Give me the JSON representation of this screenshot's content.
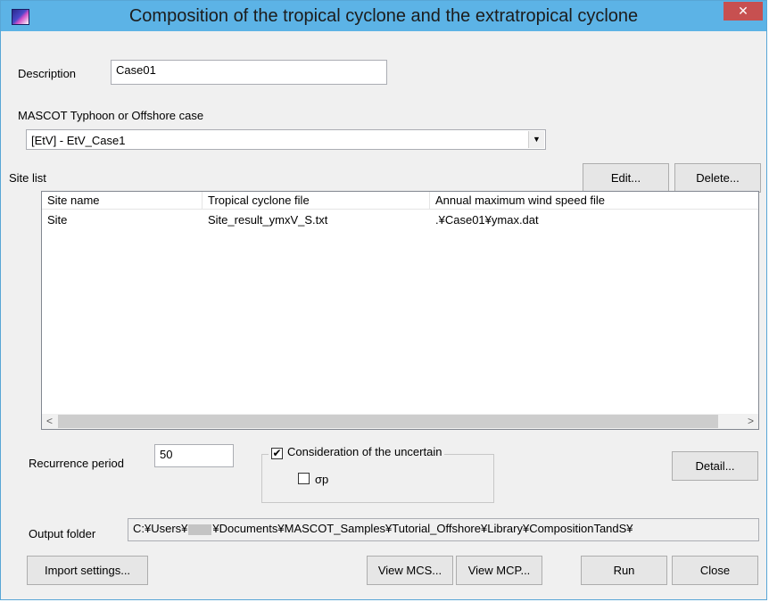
{
  "window": {
    "title": "Composition of the tropical cyclone and the extratropical cyclone",
    "close_glyph": "✕"
  },
  "description": {
    "label": "Description",
    "value": "Case01"
  },
  "mascot_case": {
    "label": "MASCOT Typhoon or Offshore case",
    "selected": "[EtV] - EtV_Case1"
  },
  "site_list": {
    "label": "Site list",
    "edit_label": "Edit...",
    "delete_label": "Delete...",
    "columns": [
      "Site name",
      "Tropical cyclone file",
      "Annual maximum wind speed file"
    ],
    "rows": [
      [
        "Site",
        "Site_result_ymxV_S.txt",
        ".¥Case01¥ymax.dat"
      ]
    ]
  },
  "recurrence": {
    "label": "Recurrence period",
    "value": "50"
  },
  "uncertainty": {
    "label": "Consideration of the uncertain",
    "checked": true,
    "sigma_label": "σp",
    "sigma_checked": false
  },
  "detail_label": "Detail...",
  "output": {
    "label": "Output folder",
    "path_prefix": "C:¥Users¥",
    "path_suffix": "¥Documents¥MASCOT_Samples¥Tutorial_Offshore¥Library¥CompositionTandS¥"
  },
  "buttons": {
    "import": "Import settings...",
    "view_mcs": "View MCS...",
    "view_mcp": "View MCP...",
    "run": "Run",
    "close": "Close"
  },
  "colors": {
    "titlebar": "#5cb3e6",
    "close": "#c75050"
  }
}
